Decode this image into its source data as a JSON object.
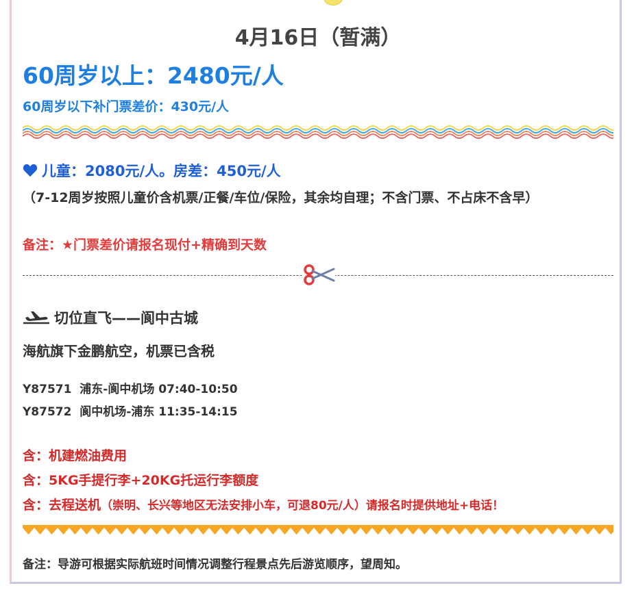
{
  "header": {
    "title": "4月16日（暂满）"
  },
  "pricing": {
    "senior": "60周岁以上：2480元/人",
    "under_60": "60周岁以下补门票差价：430元/人"
  },
  "children": {
    "price": "儿童：2080元/人。房差：450元/人",
    "note": "（7-12周岁按照儿童价含机票/正餐/车位/保险，其余均自理；不含门票、不占床不含早）",
    "remark": "备注：★门票差价请报名现付+精确到天数"
  },
  "flight": {
    "title": "切位直飞——阆中古城",
    "airline": "海航旗下金鹏航空，机票已含税",
    "rows": [
      "Y87571  浦东-阆中机场 07:40-10:50",
      "Y87572  阆中机场-浦东 11:35-14:15"
    ]
  },
  "includes": {
    "line1": "含：机建燃油费用",
    "line2": "含：5KG手提行李+20KG托运行李额度",
    "line3_main": "含：去程送机",
    "line3_detail": "（崇明、长兴等地区无法安排小车，可退80元/人）请报名时提供地址+电话！"
  },
  "footer": {
    "note": "备注：导游可根据实际航班时间情况调整行程景点先后游览顺序，望周知。"
  },
  "colors": {
    "blue": "#1e7fe0",
    "deep_blue": "#1f5fd6",
    "red": "#d42a2a",
    "text": "#333333",
    "zigzag": "#f5a623"
  },
  "icons": [
    "sun-icon",
    "heart-icon",
    "scissors-icon",
    "plane-icon"
  ]
}
